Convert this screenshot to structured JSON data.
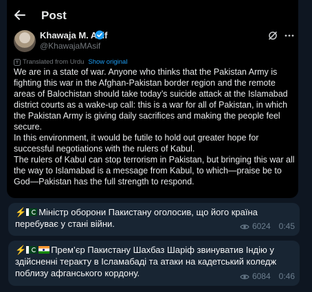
{
  "post_header": {
    "title": "Post"
  },
  "author": {
    "name": "Khawaja M. Asif",
    "handle": "@KhawajaMAsif"
  },
  "translation": {
    "note": "Translated from Urdu",
    "show_original": "Show original"
  },
  "post_body": "We are in a state of war. Anyone who thinks that the Pakistan Army is fighting this war in the Afghan-Pakistan border region and the remote areas of Balochistan should take today’s suicide attack at the Islamabad district courts as a wake-up call: this is a war for all of Pakistan, in which the Pakistan Army is giving daily sacrifices and making the people feel secure.\nIn this environment, it would be futile to hold out greater hope for successful negotiations with the rulers of Kabul.\nThe rulers of Kabul can stop terrorism in Pakistan, but bringing this war all the way to Islamabad is a message from Kabul, to which—praise be to God—Pakistan has the full strength to respond.",
  "messages": [
    {
      "text": "Міністр оборони Пакистану оголосив, що його країна перебуває у стані війни.",
      "views": "6024",
      "time": "0:45"
    },
    {
      "text": "Прем’єр Пакистану Шахбаз Шаріф звинуватив Індію у здійсненні теракту в Ісламабаді та атаки на кадетський коледж поблизу афганського кордону.",
      "views": "6084",
      "time": "0:46"
    }
  ],
  "icons": {
    "back": "arrow-left-icon",
    "verified": "verified-badge-icon",
    "grok": "grok-icon",
    "more": "more-icon",
    "views": "eye-icon",
    "emoji": "lightning-emoji"
  },
  "colors": {
    "x_background": "#000000",
    "telegram_background": "#0e1621",
    "bubble": "#182533",
    "link": "#1d9bf0"
  }
}
